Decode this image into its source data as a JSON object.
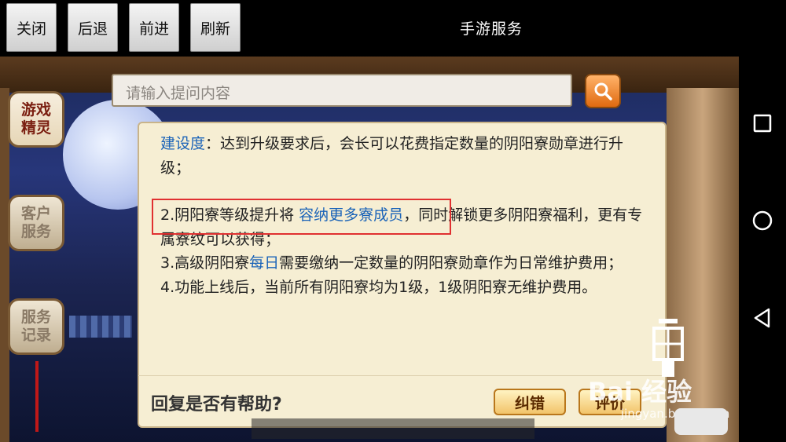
{
  "toolbar": {
    "close_label": "关闭",
    "back_label": "后退",
    "forward_label": "前进",
    "refresh_label": "刷新",
    "title": "手游服务"
  },
  "sidebar": {
    "items": [
      {
        "label": "游戏\n精灵",
        "active": true
      },
      {
        "label": "客户\n服务",
        "active": false
      },
      {
        "label": "服务\n记录",
        "active": false
      }
    ]
  },
  "search": {
    "placeholder": "请输入提问内容",
    "icon": "search-icon"
  },
  "answer": {
    "line1_label": "建设度",
    "line1_text": "：达到升级要求后，会长可以花费指定数量的阴阳寮勋章进行升级；",
    "item2_pre": "2.阴阳寮等级提升将 ",
    "item2_link": "容纳更多寮成员",
    "item2_post": "，同时解锁更多阴阳寮福利，更有专属寮纹可以获得；",
    "item3_pre": "3.高级阴阳寮",
    "item3_link": "每日",
    "item3_post": "需要缴纳一定数量的阴阳寮勋章作为日常维护费用；",
    "item4": "4.功能上线后，当前所有阴阳寮均为1级，1级阴阳寮无维护费用。"
  },
  "feedback": {
    "question": "回复是否有帮助?",
    "button1": "纠错",
    "button2": "评价"
  },
  "watermark": {
    "brand": "Bai 经验",
    "url": "jingyan.baidu.com"
  },
  "colors": {
    "link_blue": "#1a63b8",
    "highlight_red": "#e03030",
    "panel_bg": "#f6eed3",
    "search_orange": "#e06a10"
  }
}
